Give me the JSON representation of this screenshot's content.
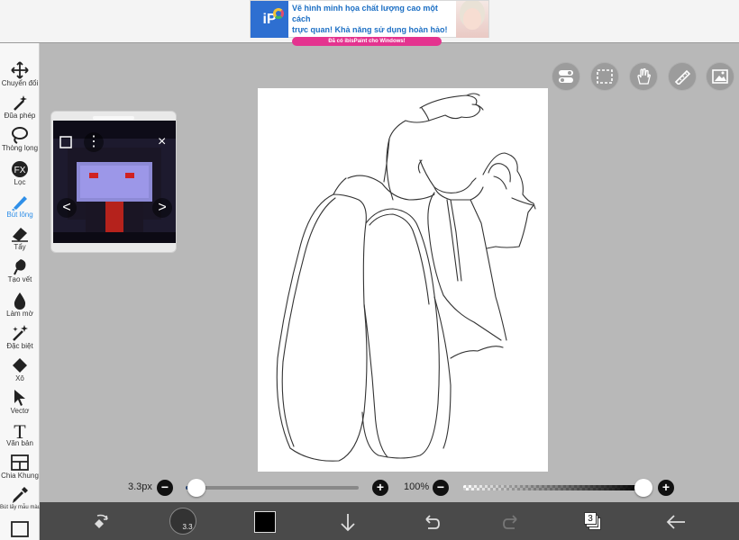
{
  "ad": {
    "logo_text": "iP",
    "line1": "Vẽ hình minh họa chất lượng cao một cách",
    "line2": "trực quan! Khả năng sử dụng hoàn hảo!",
    "cta": "Đã có ibisPaint cho Windows!"
  },
  "tools": [
    {
      "label": "Chuyển đổi",
      "icon": "move-icon"
    },
    {
      "label": "Đũa phép",
      "icon": "magic-wand-icon"
    },
    {
      "label": "Thòng lọng",
      "icon": "lasso-icon"
    },
    {
      "label": "Lọc",
      "icon": "fx-filter-icon",
      "icon_text": "FX"
    },
    {
      "label": "Bút lông",
      "icon": "brush-icon",
      "active": true
    },
    {
      "label": "Tẩy",
      "icon": "eraser-icon"
    },
    {
      "label": "Tạo vết",
      "icon": "smudge-icon"
    },
    {
      "label": "Làm mờ",
      "icon": "blur-drop-icon"
    },
    {
      "label": "Đặc biệt",
      "icon": "special-wand-icon"
    },
    {
      "label": "Xô",
      "icon": "bucket-icon"
    },
    {
      "label": "Vectơ",
      "icon": "vector-cursor-icon"
    },
    {
      "label": "Văn bản",
      "icon": "text-icon",
      "icon_text": "T"
    },
    {
      "label": "Chia Khung",
      "icon": "frame-divider-icon"
    },
    {
      "label": "Bút lấy mẫu màu",
      "icon": "eyedropper-icon"
    },
    {
      "label": "",
      "icon": "canvas-icon"
    }
  ],
  "quick_buttons": [
    "toggle-icon",
    "selection-icon",
    "hand-icon",
    "ruler-icon",
    "reference-image-icon"
  ],
  "brush": {
    "size_label": "3.3px",
    "size_fraction": 0.06,
    "opacity_label": "100%",
    "opacity_fraction": 1.0,
    "size_badge": "3.3"
  },
  "layers": {
    "count": "3"
  },
  "colors": {
    "accent": "#2f8fe8",
    "current_color": "#000000",
    "rail_bg": "#f7f7f7",
    "workspace_bg": "#b8b8b8",
    "bottombar_bg": "#4a4a4a"
  },
  "reference": {
    "close_glyph": "×",
    "prev_glyph": "<",
    "next_glyph": ">",
    "menu_glyph": "⋮"
  }
}
